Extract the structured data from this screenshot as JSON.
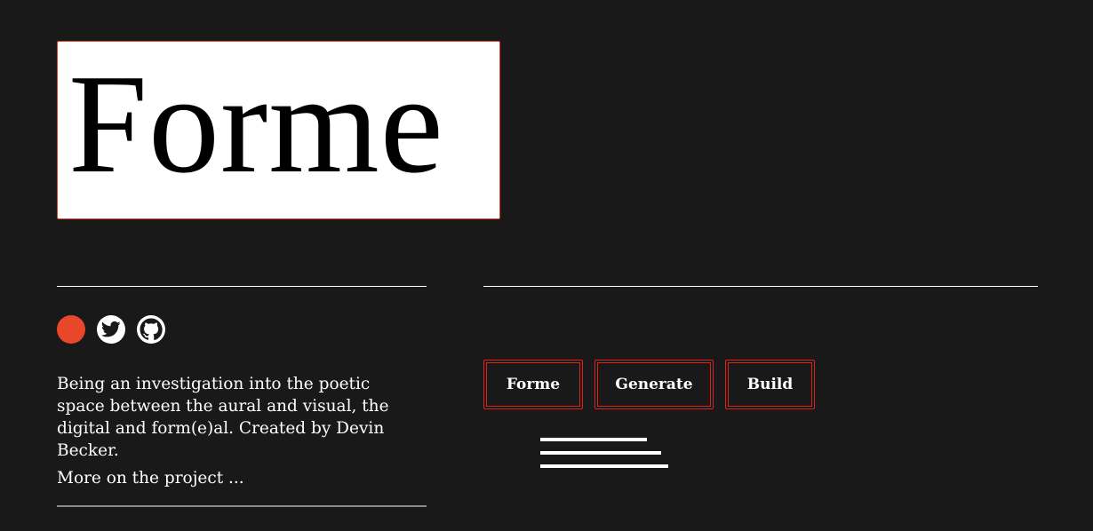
{
  "logo": {
    "text": "Forme"
  },
  "social": {
    "icons": [
      "orange-dot-icon",
      "twitter-icon",
      "github-icon"
    ],
    "accent": "#e8472a"
  },
  "intro": {
    "description": "Being an investigation into the poetic space between the aural and visual, the digital and form(e)al. Created by Devin Becker.",
    "more_link": "More on the project ..."
  },
  "nav": {
    "buttons": [
      {
        "label": "Forme"
      },
      {
        "label": "Generate"
      },
      {
        "label": "Build"
      }
    ],
    "border_color": "#e0201a"
  },
  "menu": {
    "icon": "hamburger-menu-icon"
  },
  "colors": {
    "background": "#191919",
    "text": "#ffffff",
    "logo_border": "#d9472b"
  }
}
